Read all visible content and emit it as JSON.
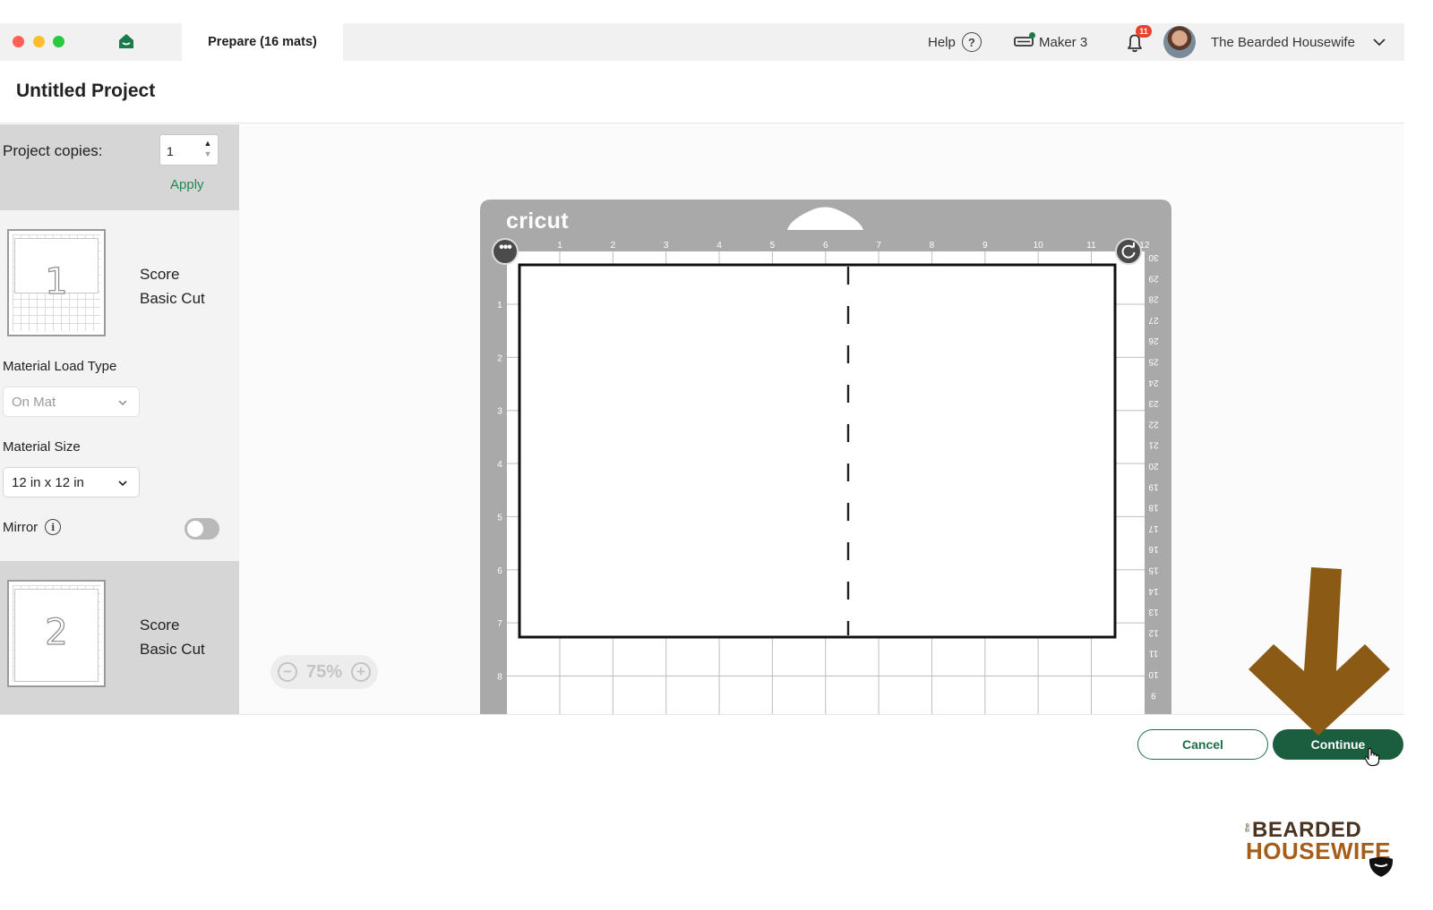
{
  "titlebar": {
    "tab_label": "Prepare (16 mats)",
    "help_label": "Help",
    "help_icon": "?",
    "machine_label": "Maker 3",
    "notification_count": "11",
    "user_name": "The Bearded Housewife"
  },
  "project": {
    "title": "Untitled Project"
  },
  "sidebar": {
    "copies_label": "Project copies:",
    "copies_value": "1",
    "apply_label": "Apply",
    "mats": [
      {
        "number": "1",
        "operation_1": "Score",
        "operation_2": "Basic Cut"
      },
      {
        "number": "2",
        "operation_1": "Score",
        "operation_2": "Basic Cut"
      }
    ],
    "load_type_label": "Material Load Type",
    "load_type_value": "On Mat",
    "size_label": "Material Size",
    "size_value": "12 in x 12 in",
    "mirror_label": "Mirror",
    "mirror_on": false
  },
  "canvas": {
    "brand": "cricut",
    "menu_glyph": "•••",
    "zoom_minus": "−",
    "zoom_value": "75%",
    "zoom_plus": "+",
    "top_ruler": [
      "1",
      "2",
      "3",
      "4",
      "5",
      "6",
      "7",
      "8",
      "9",
      "10",
      "11",
      "12"
    ],
    "left_ruler": [
      "1",
      "2",
      "3",
      "4",
      "5",
      "6",
      "7",
      "8"
    ],
    "right_ruler": [
      "30",
      "29",
      "28",
      "27",
      "26",
      "25",
      "24",
      "23",
      "22",
      "21",
      "20",
      "19",
      "18",
      "17",
      "16",
      "15",
      "14",
      "13",
      "12",
      "11",
      "10",
      "9"
    ]
  },
  "footer": {
    "cancel_label": "Cancel",
    "continue_label": "Continue"
  },
  "watermark": {
    "small": "the",
    "line1": "BEARDED",
    "line2": "HOUSEWIFE"
  },
  "colors": {
    "accent_green": "#1b5e3f",
    "apply_green": "#1e8a55",
    "mat_gray": "#a9a9a9",
    "annotation_arrow": "#8b5a14",
    "notification_red": "#e8442d"
  }
}
